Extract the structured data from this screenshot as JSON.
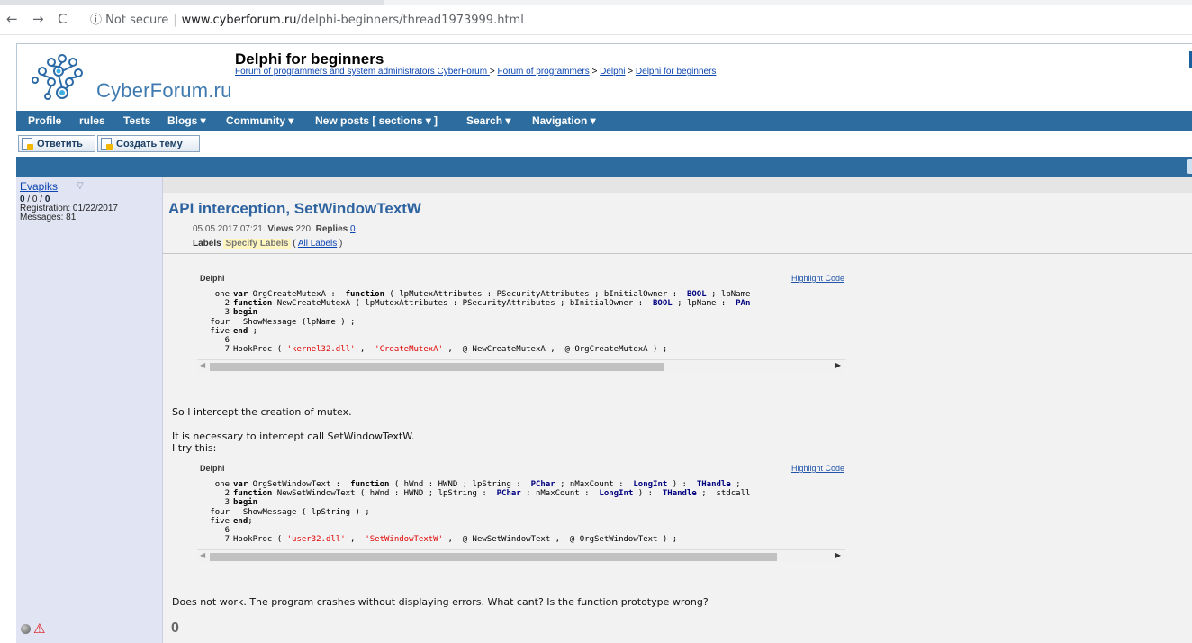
{
  "browser": {
    "back": "←",
    "forward": "→",
    "reload": "C",
    "security_icon": "ⓘ",
    "security": "Not secure",
    "url_host": "www.cyberforum.ru",
    "url_path": "/delphi-beginners/thread1973999.html"
  },
  "header": {
    "logo_text": "CyberForum.ru",
    "forum_title": "Delphi for beginners",
    "breadcrumb": [
      "Forum of programmers and system administrators CyberForum ",
      "Forum of programmers",
      "Delphi",
      "Delphi for beginners"
    ],
    "breadcrumb_sep": " > "
  },
  "navbar": {
    "items": [
      "Profile",
      "rules",
      "Tests",
      "Blogs ▾",
      "Community ▾",
      "New posts [ sections ▾ ]",
      "Search ▾",
      "Navigation ▾"
    ]
  },
  "actions": {
    "reply": "Ответить",
    "create_topic": "Создать тему"
  },
  "user": {
    "name": "Evapiks",
    "arrow": "▽",
    "stat_a": "0",
    "stat_sep": " / ",
    "stat_b": "0",
    "stat_c": "0",
    "registration": "Registration: 01/22/2017",
    "messages": "Messages: 81"
  },
  "post": {
    "title": "API interception, SetWindowTextW",
    "date": "05.05.2017 07:21.",
    "views_label": "Views",
    "views": "220.",
    "replies_label": "Replies",
    "replies": "0",
    "labels_label": "Labels",
    "specify_labels": "Specify Labels",
    "all_labels": "All Labels",
    "text1": "So I intercept the creation of mutex.",
    "text2": "It is necessary to intercept call SetWindowTextW.",
    "text3": "I try this:",
    "text4": "Does not work. The program crashes without displaying errors. What cant? Is the function prototype wrong?",
    "rating": "0"
  },
  "code_blocks": [
    {
      "lang": "Delphi",
      "highlight": "Highlight Code",
      "lines": [
        "one var OrgCreateMutexA :  function ( lpMutexAttributes : PSecurityAttributes ; bInitialOwner :  BOOL ; lpName",
        "2 function NewCreateMutexA ( lpMutexAttributes : PSecurityAttributes ; bInitialOwner :  BOOL ; lpName :  PAn",
        "3 begin",
        "four   ShowMessage (lpName ) ;",
        "five end ;",
        "6",
        "7 HookProc ( 'kernel32.dll' ,  'CreateMutexA' ,  @ NewCreateMutexA ,  @ OrgCreateMutexA ) ;"
      ]
    },
    {
      "lang": "Delphi",
      "highlight": "Highlight Code",
      "lines": [
        "one var OrgSetWindowText :  function ( hWnd : HWND ; lpString :  PChar ; nMaxCount :  LongInt ) :  THandle ;",
        "2 function NewSetWindowText ( hWnd : HWND ; lpString :  PChar ; nMaxCount :  LongInt ) :  THandle ;  stdcall",
        "3 begin",
        "four   ShowMessage ( lpString ) ;",
        "five end;",
        "6",
        "7 HookProc ( 'user32.dll' ,  'SetWindowTextW' ,  @ NewSetWindowText ,  @ OrgSetWindowText ) ;"
      ]
    }
  ]
}
